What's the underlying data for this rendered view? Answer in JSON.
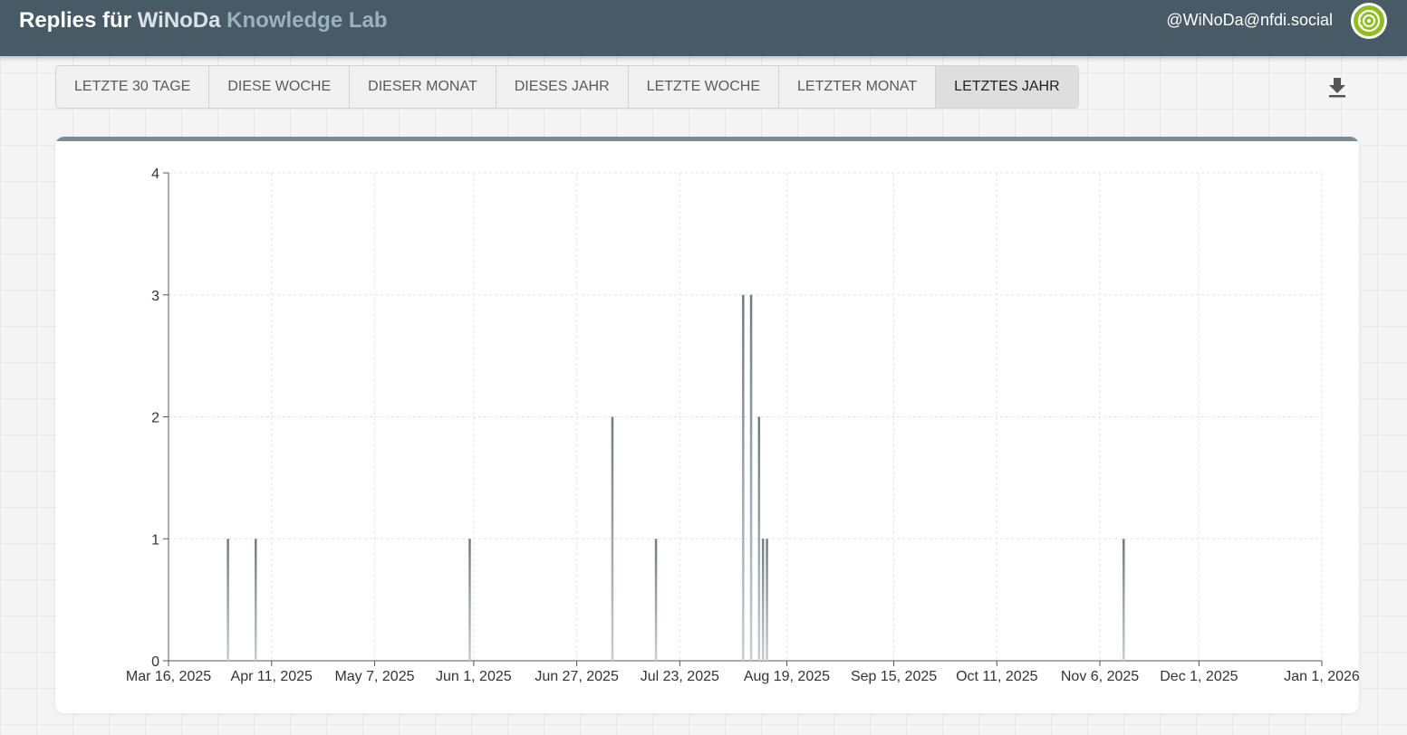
{
  "header": {
    "title_prefix": "Replies für ",
    "brand_part1": "WiNoDa",
    "brand_part2": "Knowledge Lab",
    "account": "@WiNoDa@nfdi.social",
    "avatar_icon": "winoda-logo-icon"
  },
  "tabs": [
    {
      "label": "LETZTE 30 TAGE",
      "active": false
    },
    {
      "label": "DIESE WOCHE",
      "active": false
    },
    {
      "label": "DIESER MONAT",
      "active": false
    },
    {
      "label": "DIESES JAHR",
      "active": false
    },
    {
      "label": "LETZTE WOCHE",
      "active": false
    },
    {
      "label": "LETZTER MONAT",
      "active": false
    },
    {
      "label": "LETZTES JAHR",
      "active": true
    }
  ],
  "toolbar": {
    "download_icon": "download-icon"
  },
  "colors": {
    "header_bg": "#475a66",
    "bar": "#6d7c86",
    "accent_top": "#7b8c96"
  },
  "chart_data": {
    "type": "bar",
    "x_type": "date",
    "xlim": [
      "2025-03-16",
      "2026-01-01"
    ],
    "ylim": [
      0,
      4
    ],
    "y_ticks": [
      0,
      1,
      2,
      3,
      4
    ],
    "x_ticks": [
      {
        "date": "2025-03-16",
        "label": "Mar 16, 2025"
      },
      {
        "date": "2025-04-11",
        "label": "Apr 11, 2025"
      },
      {
        "date": "2025-05-07",
        "label": "May 7, 2025"
      },
      {
        "date": "2025-06-01",
        "label": "Jun 1, 2025"
      },
      {
        "date": "2025-06-27",
        "label": "Jun 27, 2025"
      },
      {
        "date": "2025-07-23",
        "label": "Jul 23, 2025"
      },
      {
        "date": "2025-08-19",
        "label": "Aug 19, 2025"
      },
      {
        "date": "2025-09-15",
        "label": "Sep 15, 2025"
      },
      {
        "date": "2025-10-11",
        "label": "Oct 11, 2025"
      },
      {
        "date": "2025-11-06",
        "label": "Nov 6, 2025"
      },
      {
        "date": "2025-12-01",
        "label": "Dec 1, 2025"
      },
      {
        "date": "2026-01-01",
        "label": "Jan 1, 2026"
      }
    ],
    "points": [
      {
        "date": "2025-03-31",
        "value": 1
      },
      {
        "date": "2025-04-07",
        "value": 1
      },
      {
        "date": "2025-05-31",
        "value": 1
      },
      {
        "date": "2025-07-06",
        "value": 2
      },
      {
        "date": "2025-07-17",
        "value": 1
      },
      {
        "date": "2025-08-08",
        "value": 3
      },
      {
        "date": "2025-08-10",
        "value": 3
      },
      {
        "date": "2025-08-12",
        "value": 2
      },
      {
        "date": "2025-08-13",
        "value": 1
      },
      {
        "date": "2025-08-14",
        "value": 1
      },
      {
        "date": "2025-11-12",
        "value": 1
      }
    ],
    "grid": true,
    "legend": "none"
  }
}
